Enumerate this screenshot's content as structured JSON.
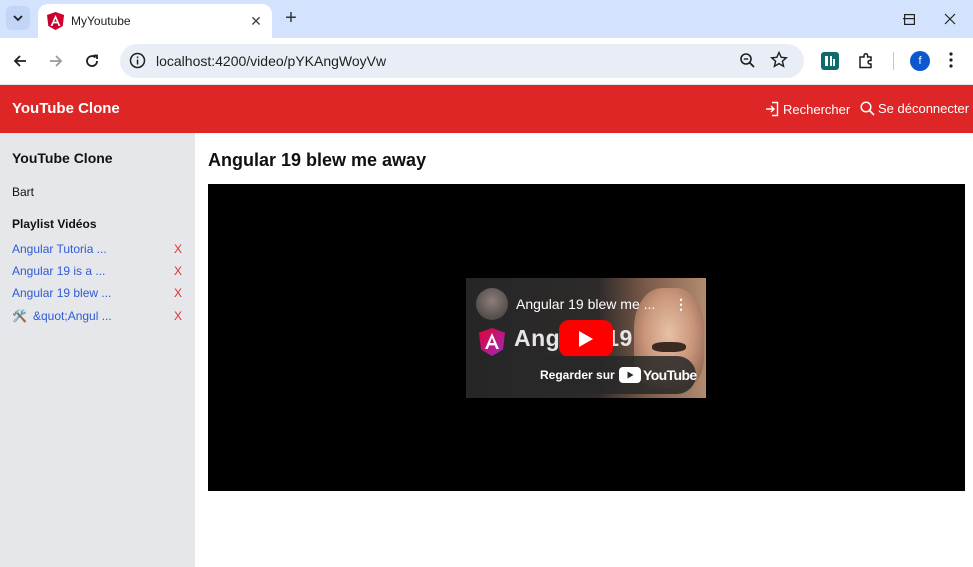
{
  "browser": {
    "tab_title": "MyYoutube",
    "url": "localhost:4200/video/pYKAngWoyVw",
    "profile_initial": "f"
  },
  "header": {
    "brand": "YouTube Clone",
    "search_label": "Rechercher",
    "logout_label": "Se déconnecter",
    "color": "#de2626"
  },
  "sidebar": {
    "title": "YouTube Clone",
    "user": "Bart",
    "playlist_title": "Playlist Vidéos",
    "items": [
      {
        "label": "Angular Tutoria ...",
        "delete": "X"
      },
      {
        "label": "Angular 19 is a ...",
        "delete": "X"
      },
      {
        "label": "Angular 19 blew ...",
        "delete": "X"
      },
      {
        "label": "&quot;Angul ...",
        "delete": "X",
        "emoji": "🛠️"
      }
    ]
  },
  "main": {
    "title": "Angular 19 blew me away",
    "player": {
      "video_title": "Angular 19 blew me ...",
      "thumb_text": "Angu 19",
      "thumb_text_left": "Ang",
      "thumb_text_right": "19",
      "watch_on": "Regarder sur",
      "yt_word": "YouTube"
    }
  }
}
